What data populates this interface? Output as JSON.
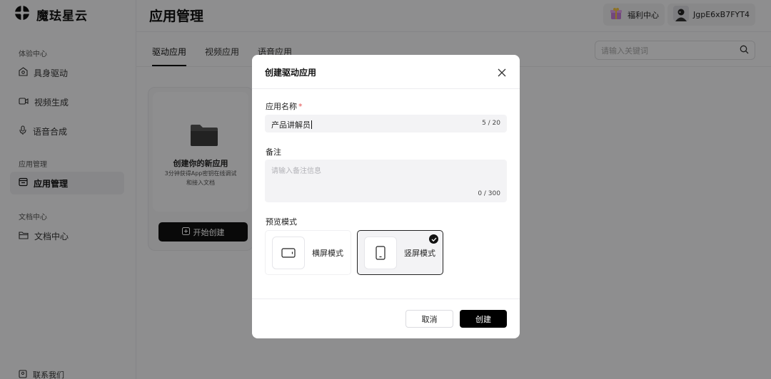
{
  "app": {
    "brand": "魔珐星云"
  },
  "sidebar": {
    "groups": [
      {
        "title": "体验中心",
        "items": [
          {
            "label": "具身驱动",
            "icon": "face-scan-icon"
          },
          {
            "label": "视频生成",
            "icon": "video-camera-icon"
          },
          {
            "label": "语音合成",
            "icon": "microphone-icon"
          }
        ]
      },
      {
        "title": "应用管理",
        "items": [
          {
            "label": "应用管理",
            "icon": "app-window-icon",
            "active": true
          }
        ]
      },
      {
        "title": "文档中心",
        "items": [
          {
            "label": "文档中心",
            "icon": "folder-icon"
          }
        ]
      }
    ],
    "contact": "联系我们"
  },
  "header": {
    "title": "应用管理",
    "benefits": "福利中心",
    "user": "JgpE6xB7FYT4"
  },
  "tabs": [
    "驱动应用",
    "视频应用",
    "语音应用"
  ],
  "search": {
    "placeholder": "请输入关键词"
  },
  "create_card": {
    "title": "创建你的新应用",
    "desc": "3分钟获得App密钥在线调试和接入文档",
    "button": "开始创建"
  },
  "modal": {
    "title": "创建驱动应用",
    "name_label": "应用名称",
    "required_mark": "*",
    "name_value": "产品讲解员",
    "name_count": "5 / 20",
    "note_label": "备注",
    "note_placeholder": "请输入备注信息",
    "note_count": "0 / 300",
    "mode_label": "预览模式",
    "modes": [
      {
        "label": "横屏模式",
        "selected": false
      },
      {
        "label": "竖屏模式",
        "selected": true
      }
    ],
    "cancel": "取消",
    "confirm": "创建"
  }
}
